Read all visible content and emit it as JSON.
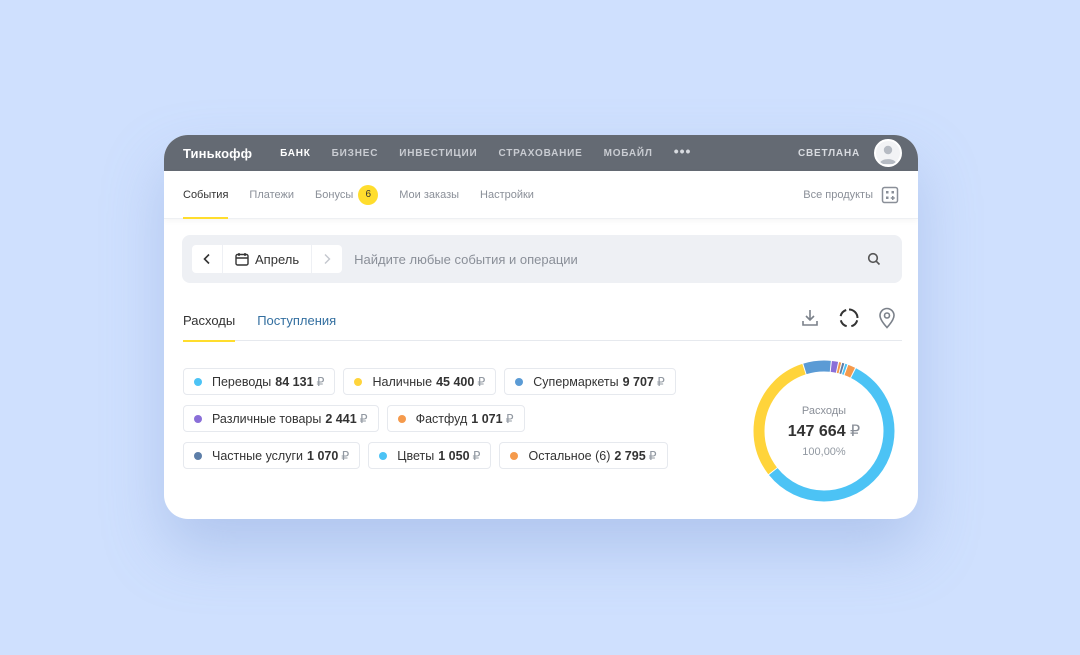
{
  "topbar": {
    "logo": "Тинькофф",
    "items": [
      {
        "label": "БАНК",
        "active": true
      },
      {
        "label": "БИЗНЕС"
      },
      {
        "label": "ИНВЕСТИЦИИ"
      },
      {
        "label": "СТРАХОВАНИЕ"
      },
      {
        "label": "МОБАЙЛ"
      }
    ],
    "more": "•••",
    "user": "СВЕТЛАНА"
  },
  "subnav": {
    "tabs": [
      {
        "label": "События",
        "active": true
      },
      {
        "label": "Платежи"
      },
      {
        "label": "Бонусы",
        "badge": "6"
      },
      {
        "label": "Мои заказы"
      },
      {
        "label": "Настройки"
      }
    ],
    "all_products": "Все продукты"
  },
  "search": {
    "month": "Апрель",
    "placeholder": "Найдите любые события и операции"
  },
  "operation_tabs": {
    "expenses": "Расходы",
    "income": "Поступления"
  },
  "currency": "₽",
  "categories": [
    {
      "name": "Переводы",
      "amount": "84 131",
      "color": "#4cc3f5"
    },
    {
      "name": "Наличные",
      "amount": "45 400",
      "color": "#ffd43b"
    },
    {
      "name": "Супермаркеты",
      "amount": "9 707",
      "color": "#5b9bd5"
    },
    {
      "name": "Различные товары",
      "amount": "2 441",
      "color": "#8a6fd8"
    },
    {
      "name": "Фастфуд",
      "amount": "1 071",
      "color": "#f59a4c"
    },
    {
      "name": "Частные услуги",
      "amount": "1 070",
      "color": "#5d7ea8"
    },
    {
      "name": "Цветы",
      "amount": "1 050",
      "color": "#4cc3f5"
    },
    {
      "name": "Остальное (6)",
      "amount": "2 795",
      "color": "#f59a4c"
    }
  ],
  "summary": {
    "label": "Расходы",
    "total": "147 664",
    "percent": "100,00%"
  }
}
